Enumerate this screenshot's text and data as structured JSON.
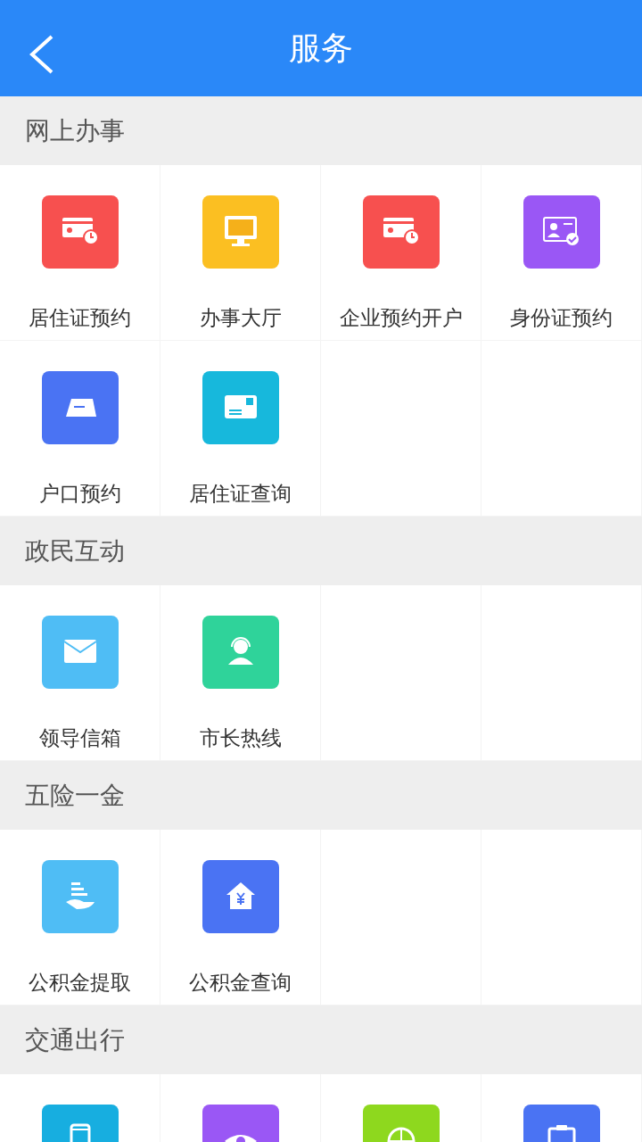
{
  "header": {
    "title": "服务"
  },
  "sections": [
    {
      "title": "网上办事",
      "items": [
        {
          "label": "居住证预约",
          "kind": "card-clock",
          "color": "#f7504f"
        },
        {
          "label": "办事大厅",
          "kind": "monitor",
          "color": "#fbbf22"
        },
        {
          "label": "企业预约开户",
          "kind": "card-clock",
          "color": "#f7504f"
        },
        {
          "label": "身份证预约",
          "kind": "card-check",
          "color": "#9a57f5"
        },
        {
          "label": "户口预约",
          "kind": "tent",
          "color": "#4a73f3"
        },
        {
          "label": "居住证查询",
          "kind": "card",
          "color": "#17b8dc"
        }
      ]
    },
    {
      "title": "政民互动",
      "items": [
        {
          "label": "领导信箱",
          "kind": "mail",
          "color": "#4fbdf5"
        },
        {
          "label": "市长热线",
          "kind": "headset",
          "color": "#2fd39a"
        }
      ]
    },
    {
      "title": "五险一金",
      "items": [
        {
          "label": "公积金提取",
          "kind": "hand",
          "color": "#4fbdf5"
        },
        {
          "label": "公积金查询",
          "kind": "house",
          "color": "#4a73f3"
        }
      ]
    },
    {
      "title": "交通出行",
      "items": [
        {
          "kind": "phone",
          "color": "#17aee0"
        },
        {
          "kind": "eye",
          "color": "#9a57f5"
        },
        {
          "kind": "globe",
          "color": "#8ed81e"
        },
        {
          "kind": "clipboard",
          "color": "#4a73f3"
        }
      ]
    }
  ]
}
